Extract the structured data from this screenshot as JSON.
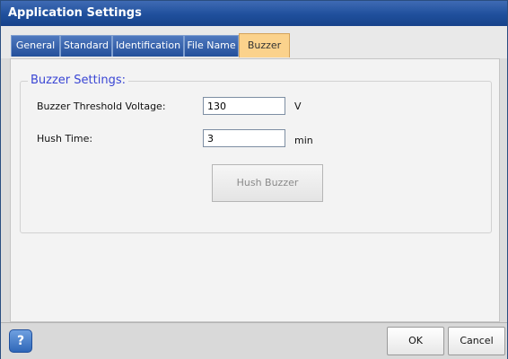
{
  "window": {
    "title": "Application Settings"
  },
  "tabs": [
    {
      "label": "General"
    },
    {
      "label": "Standard"
    },
    {
      "label": "Identification"
    },
    {
      "label": "File Name"
    },
    {
      "label": "Buzzer"
    }
  ],
  "active_tab": "Buzzer",
  "buzzer": {
    "group_title": "Buzzer Settings:",
    "threshold_label": "Buzzer Threshold Voltage:",
    "threshold_value": "130",
    "threshold_unit": "V",
    "hush_label": "Hush Time:",
    "hush_value": "3",
    "hush_unit": "min",
    "hush_button": "Hush Buzzer"
  },
  "footer": {
    "help_icon": "help-icon",
    "help_glyph": "?",
    "ok_label": "OK",
    "cancel_label": "Cancel"
  },
  "colors": {
    "titlebar": "#1f4f9c",
    "active_tab": "#fbd28c",
    "group_title": "#3a46d4"
  }
}
